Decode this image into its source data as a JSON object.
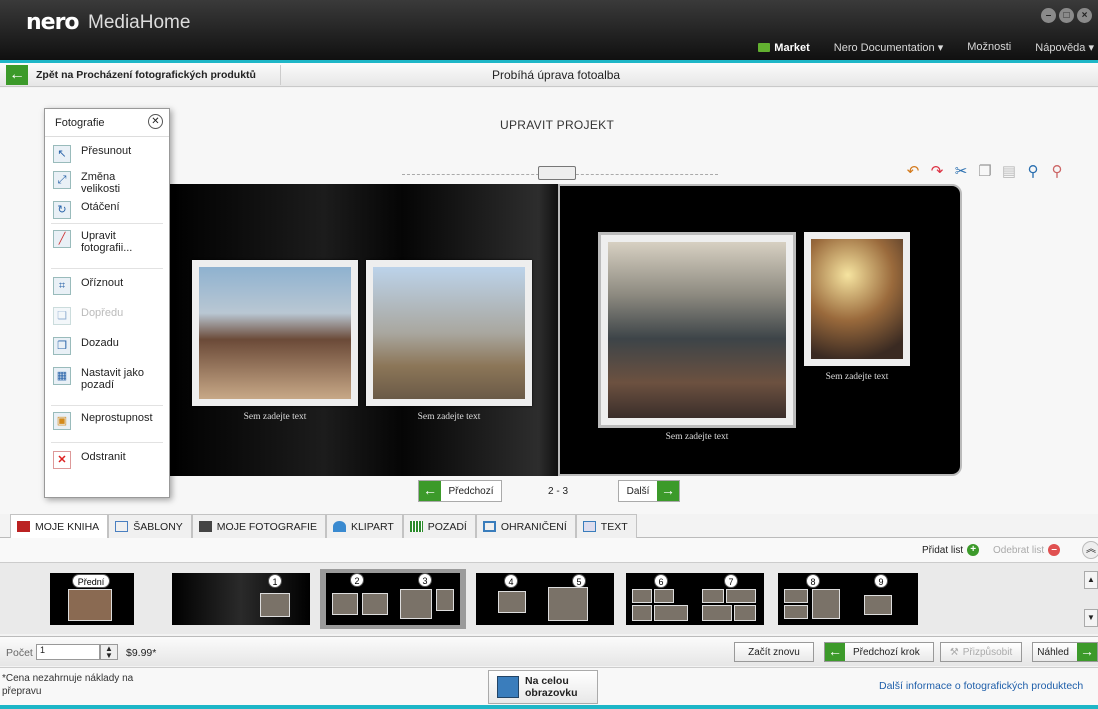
{
  "app": {
    "logo": "nero",
    "name": "MediaHome",
    "window_buttons": [
      "minimize",
      "maximize",
      "close"
    ]
  },
  "top_menu": {
    "market": "Market",
    "documentation": "Nero Documentation ▾",
    "options": "Možnosti",
    "help": "Nápověda ▾"
  },
  "nav": {
    "back_label": "Zpět na Procházení fotografických produktů",
    "title": "Probíhá úprava fotoalba"
  },
  "editor": {
    "heading": "UPRAVIT PROJEKT",
    "captions": {
      "left1": "Sem zadejte text",
      "left2": "Sem zadejte text",
      "right1": "Sem zadejte text",
      "right2": "Sem zadejte text"
    },
    "prev_label": "Předchozí",
    "next_label": "Další",
    "page_indicator": "2 - 3"
  },
  "tools_popup": {
    "title": "Fotografie",
    "items": {
      "move": "Přesunout",
      "resize": "Změna velikosti",
      "rotate": "Otáčení",
      "edit_photo": "Upravit fotografii...",
      "crop": "Oříznout",
      "forward": "Dopředu",
      "backward": "Dozadu",
      "set_background": "Nastavit jako pozadí",
      "opacity": "Neprostupnost",
      "remove": "Odstranit"
    }
  },
  "tabs": {
    "my_book": "MOJE KNIHA",
    "templates": "ŠABLONY",
    "my_photos": "MOJE FOTOGRAFIE",
    "clipart": "KLIPART",
    "backgrounds": "POZADÍ",
    "borders": "OHRANIČENÍ",
    "text": "TEXT"
  },
  "sheet_actions": {
    "add": "Přidat list",
    "remove": "Odebrat list"
  },
  "thumbnails": {
    "front": "Přední",
    "numbers": [
      "1",
      "2",
      "3",
      "4",
      "5",
      "6",
      "7",
      "8",
      "9"
    ]
  },
  "bottom": {
    "qty_label": "Počet",
    "qty_value": "1",
    "price": "$9.99*",
    "restart": "Začít znovu",
    "prev_step": "Předchozí krok",
    "customize": "Přizpůsobit",
    "preview": "Náhled"
  },
  "footer": {
    "footnote": "*Cena nezahrnuje náklady na přepravu",
    "fullscreen": "Na celou obrazovku",
    "more_info": "Další informace o fotografických produktech"
  },
  "colors": {
    "accent": "#1eb6c7",
    "green": "#3c9a2a",
    "titlebar": "#1a1a1a"
  }
}
